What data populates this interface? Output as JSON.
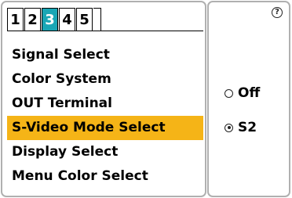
{
  "tabs": [
    "1",
    "2",
    "3",
    "4",
    "5"
  ],
  "active_tab": "3",
  "menu": {
    "items": [
      "Signal Select",
      "Color System",
      "OUT Terminal",
      "S-Video Mode Select",
      "Display Select",
      "Menu Color Select"
    ],
    "selected": "S-Video Mode Select"
  },
  "help_icon": "question-circle",
  "options": {
    "items": [
      "Off",
      "S2"
    ],
    "selected": "S2"
  },
  "colors": {
    "active_tab": "#1aa6b5",
    "highlight": "#f5b417",
    "panel_border": "#b0b0b0"
  }
}
